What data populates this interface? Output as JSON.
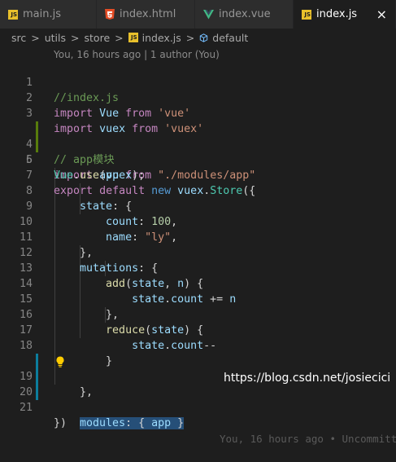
{
  "tabs": [
    {
      "label": "main.js",
      "icon": "js-file-icon",
      "active": false
    },
    {
      "label": "index.html",
      "icon": "html-file-icon",
      "active": false
    },
    {
      "label": "index.vue",
      "icon": "vue-file-icon",
      "active": false
    },
    {
      "label": "index.js",
      "icon": "js-file-icon",
      "active": true
    }
  ],
  "close_icon": "×",
  "breadcrumb": {
    "items": [
      "src",
      "utils",
      "store",
      "index.js",
      "default"
    ],
    "separator": ">"
  },
  "codelens": "You, 16 hours ago | 1 author (You)",
  "lines": [
    {
      "n": "1",
      "t": "//index.js"
    },
    {
      "n": "2",
      "t": "import Vue from 'vue'"
    },
    {
      "n": "3",
      "t": "import vuex from 'vuex'"
    },
    {
      "n": "4",
      "t": "// app模块"
    },
    {
      "n": "5",
      "t": "import app from \"./modules/app\""
    },
    {
      "n": "6",
      "t": "Vue.use(vuex);"
    },
    {
      "n": "7",
      "t": "export default new vuex.Store({"
    },
    {
      "n": "8",
      "t": "state: {"
    },
    {
      "n": "9",
      "t": "count: 100,"
    },
    {
      "n": "10",
      "t": "name: \"ly\","
    },
    {
      "n": "11",
      "t": "},"
    },
    {
      "n": "12",
      "t": "mutations: {"
    },
    {
      "n": "13",
      "t": "add(state, n) {"
    },
    {
      "n": "14",
      "t": "state.count += n"
    },
    {
      "n": "15",
      "t": "},"
    },
    {
      "n": "16",
      "t": "reduce(state) {"
    },
    {
      "n": "17",
      "t": "state.count--"
    },
    {
      "n": "18",
      "t": "}"
    },
    {
      "n": "19",
      "t": "},"
    },
    {
      "n": "20",
      "t": "modules: { app }"
    },
    {
      "n": "21",
      "t": "})"
    }
  ],
  "inline_blame": "You, 16 hours ago • Uncommitt",
  "watermark": "https://blog.csdn.net/josiecici",
  "colors": {
    "keyword": "#569cd6",
    "control": "#c586c0",
    "string": "#ce9178",
    "number": "#b5cea8",
    "property": "#9cdcfe",
    "function": "#dcdcaa",
    "class": "#4ec9b0",
    "comment": "#6a9955",
    "gutter_added": "#587c0c",
    "gutter_modified": "#0c7d9d",
    "selection": "#264f78"
  }
}
